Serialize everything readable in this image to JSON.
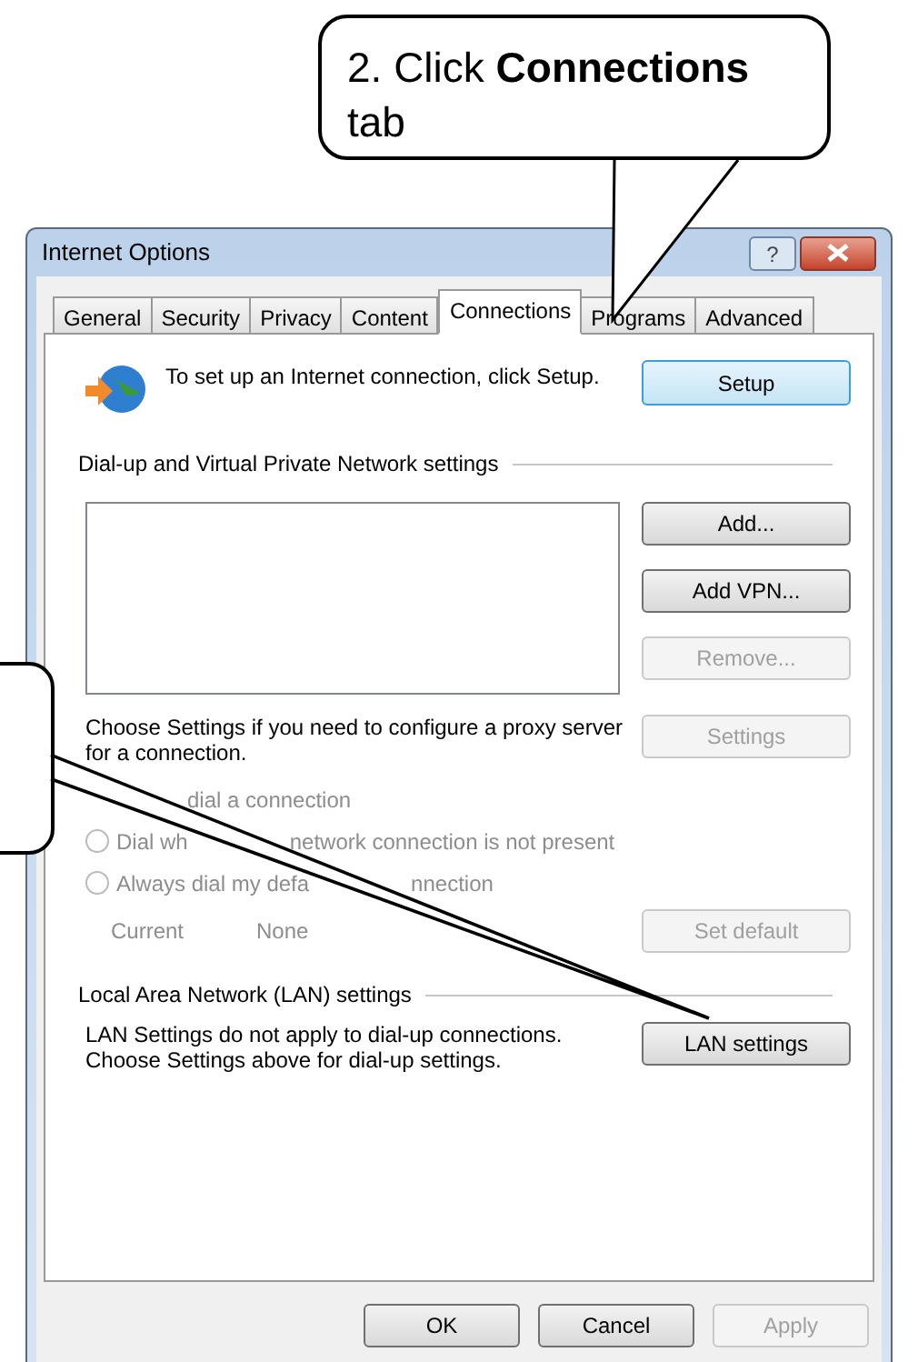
{
  "callout": {
    "text": "2. Click **Connections** tab"
  },
  "window": {
    "title": "Internet Options",
    "help": "?"
  },
  "tabs": [
    {
      "label": "General",
      "selected": false
    },
    {
      "label": "Security",
      "selected": false
    },
    {
      "label": "Privacy",
      "selected": false
    },
    {
      "label": "Content",
      "selected": false
    },
    {
      "label": "Connections",
      "selected": true
    },
    {
      "label": "Programs",
      "selected": false
    },
    {
      "label": "Advanced",
      "selected": false
    }
  ],
  "setup": {
    "text": "To set up an Internet connection, click Setup.",
    "button": "Setup"
  },
  "dialup": {
    "title": "Dial-up and Virtual Private Network settings",
    "buttons": [
      {
        "label": "Add...",
        "disabled": false
      },
      {
        "label": "Add VPN...",
        "disabled": false
      },
      {
        "label": "Remove...",
        "disabled": true
      }
    ],
    "proxy_text": "Choose Settings if you need to configure a proxy server for a connection.",
    "settings_button": {
      "label": "Settings",
      "disabled": true
    },
    "radios": [
      {
        "kind": "covered",
        "parts": [
          "dial a connection"
        ]
      },
      {
        "kind": "radio",
        "parts": [
          "Dial wh",
          "network connection is not present"
        ],
        "selected": false
      },
      {
        "kind": "radio",
        "parts": [
          "Always dial my defa",
          "nnection"
        ],
        "selected": false
      }
    ],
    "current_label": "Current",
    "current_value": "None",
    "default_button": {
      "label": "Set default",
      "disabled": true
    }
  },
  "lan": {
    "title": "Local Area Network (LAN) settings",
    "text": "LAN Settings do not apply to dial-up connections. Choose Settings above for dial-up settings.",
    "button": "LAN settings"
  },
  "footer": [
    {
      "label": "OK",
      "disabled": false
    },
    {
      "label": "Cancel",
      "disabled": false
    },
    {
      "label": "Apply",
      "disabled": true
    }
  ]
}
